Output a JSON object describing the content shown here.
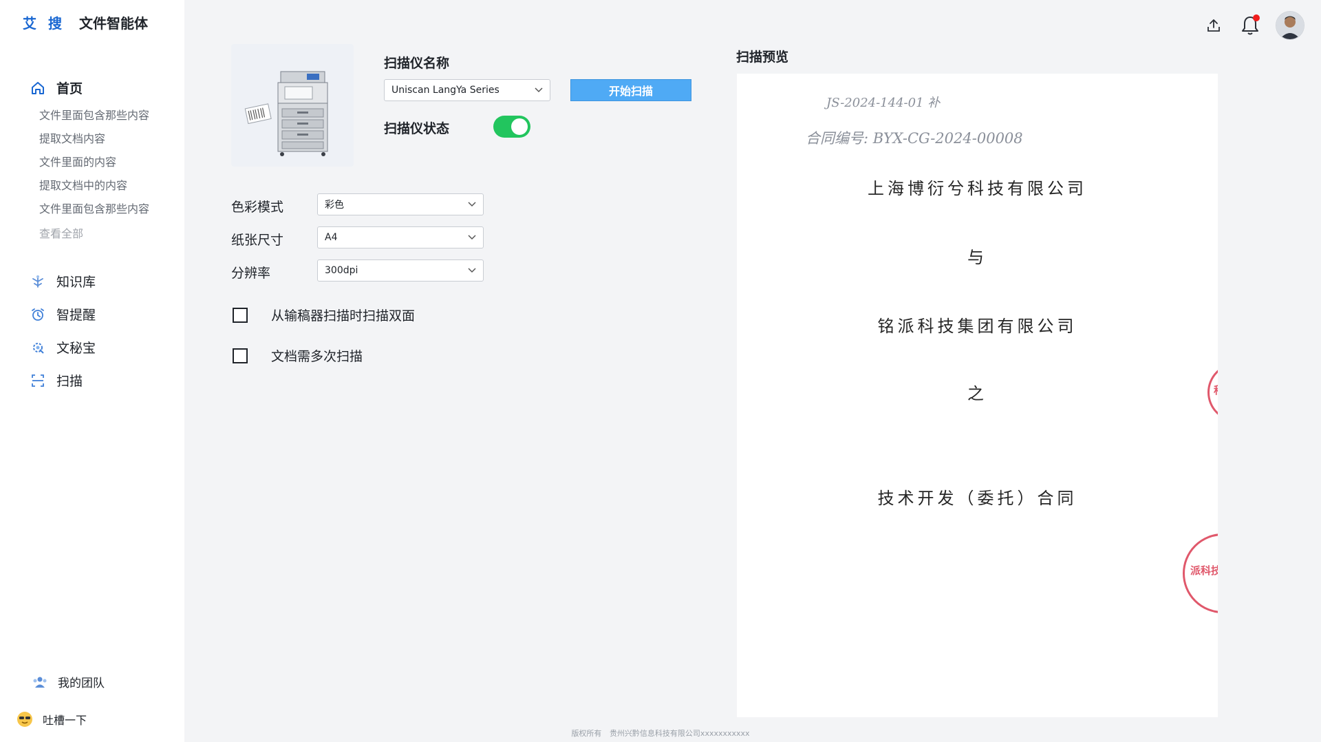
{
  "brand": {
    "logo": "艾 搜",
    "app_name": "文件智能体"
  },
  "sidebar": {
    "home_label": "首页",
    "sub_items": [
      "文件里面包含那些内容",
      "提取文档内容",
      "文件里面的内容",
      "提取文档中的内容",
      "文件里面包含那些内容"
    ],
    "view_all": "查看全部",
    "knowledge_base": "知识库",
    "smart_reminder": "智提醒",
    "secretary": "文秘宝",
    "scan": "扫描",
    "team": "我的团队",
    "feedback": "吐槽一下"
  },
  "header": {
    "icons": [
      "upload-icon",
      "bell-icon",
      "avatar"
    ]
  },
  "scanner": {
    "name_label": "扫描仪名称",
    "name_value": "Uniscan LangYa Series",
    "start_button": "开始扫描",
    "status_label": "扫描仪状态",
    "status_on": true
  },
  "settings": {
    "color_mode_label": "色彩模式",
    "color_mode_value": "彩色",
    "paper_size_label": "纸张尺寸",
    "paper_size_value": "A4",
    "resolution_label": "分辨率",
    "resolution_value": "300dpi",
    "duplex_label": "从输稿器扫描时扫描双面",
    "multi_scan_label": "文档需多次扫描"
  },
  "preview": {
    "title": "扫描预览",
    "handwriting_1": "JS-2024-144-01 补",
    "handwriting_2": "合同编号: BYX-CG-2024-00008",
    "line_company_a": "上海博衍兮科技有限公司",
    "line_and": "与",
    "line_company_b": "铭派科技集团有限公司",
    "line_of": "之",
    "line_contract": "技术开发（委托）合同",
    "stamp_text_1": "科技",
    "stamp_text_2": "派科技集团"
  },
  "footer": {
    "copyright": "版权所有",
    "company": "贵州兴黔信息科技有限公司xxxxxxxxxxx"
  },
  "colors": {
    "accent": "#4faaf5",
    "brand": "#1967d2",
    "toggle_on": "#22c55e",
    "stamp": "#e0586b",
    "notification_dot": "#f01d1d"
  }
}
